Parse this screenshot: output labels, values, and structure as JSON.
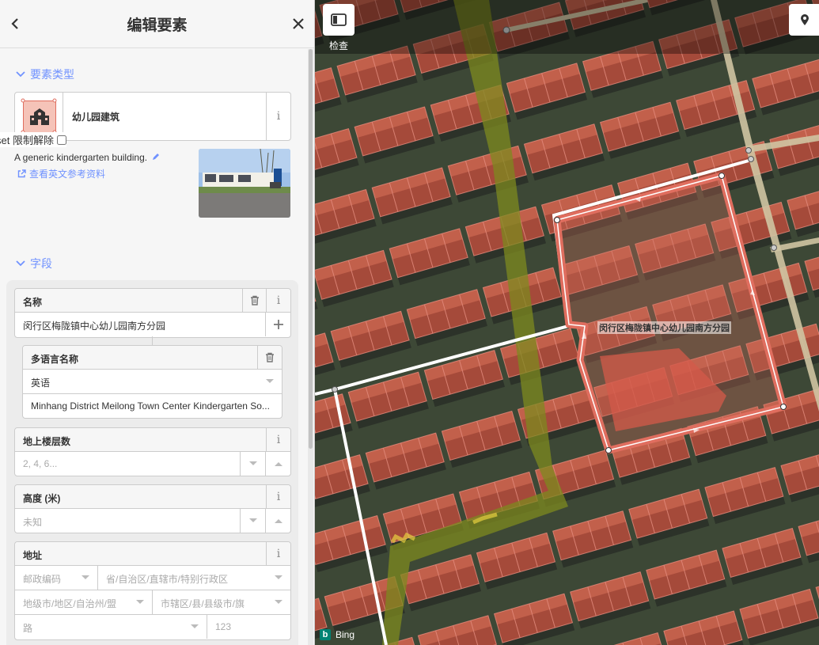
{
  "header": {
    "title": "编辑要素"
  },
  "sections": {
    "preset_type": "要素类型",
    "fields": "字段"
  },
  "preset": {
    "name": "幼儿园建筑",
    "reset_label": "set 限制解除",
    "description": "A generic kindergarten building.",
    "reference_link": "查看英文参考资料"
  },
  "fields": {
    "name": {
      "label": "名称",
      "value": "闵行区梅陇镇中心幼儿园南方分园"
    },
    "multilang": {
      "label": "多语言名称",
      "language": "英语",
      "value": "Minhang District Meilong Town Center Kindergarten So..."
    },
    "levels": {
      "label": "地上楼层数",
      "placeholder": "2, 4, 6..."
    },
    "height": {
      "label": "高度 (米)",
      "placeholder": "未知"
    },
    "address": {
      "label": "地址",
      "postcode_ph": "邮政编码",
      "province_ph": "省/自治区/直辖市/特别行政区",
      "city_ph": "地级市/地区/自治州/盟",
      "district_ph": "市辖区/县/县级市/旗",
      "street_ph": "路",
      "housenumber_ph": "123"
    }
  },
  "map": {
    "inspect_label": "检查",
    "area_label": "闵行区梅陇镇中心幼儿园南方分园",
    "imagery": "Bing"
  },
  "colors": {
    "accent": "#7092ff",
    "selected_area": "#e06e5f",
    "preset_icon_bg": "#f5c3b8"
  },
  "icons": [
    "back-icon",
    "close-icon",
    "chevron-down-icon",
    "info-icon",
    "trash-icon",
    "plus-icon",
    "pencil-icon",
    "external-link-icon",
    "school-icon",
    "sidebar-toggle-icon",
    "location-pin-icon"
  ]
}
